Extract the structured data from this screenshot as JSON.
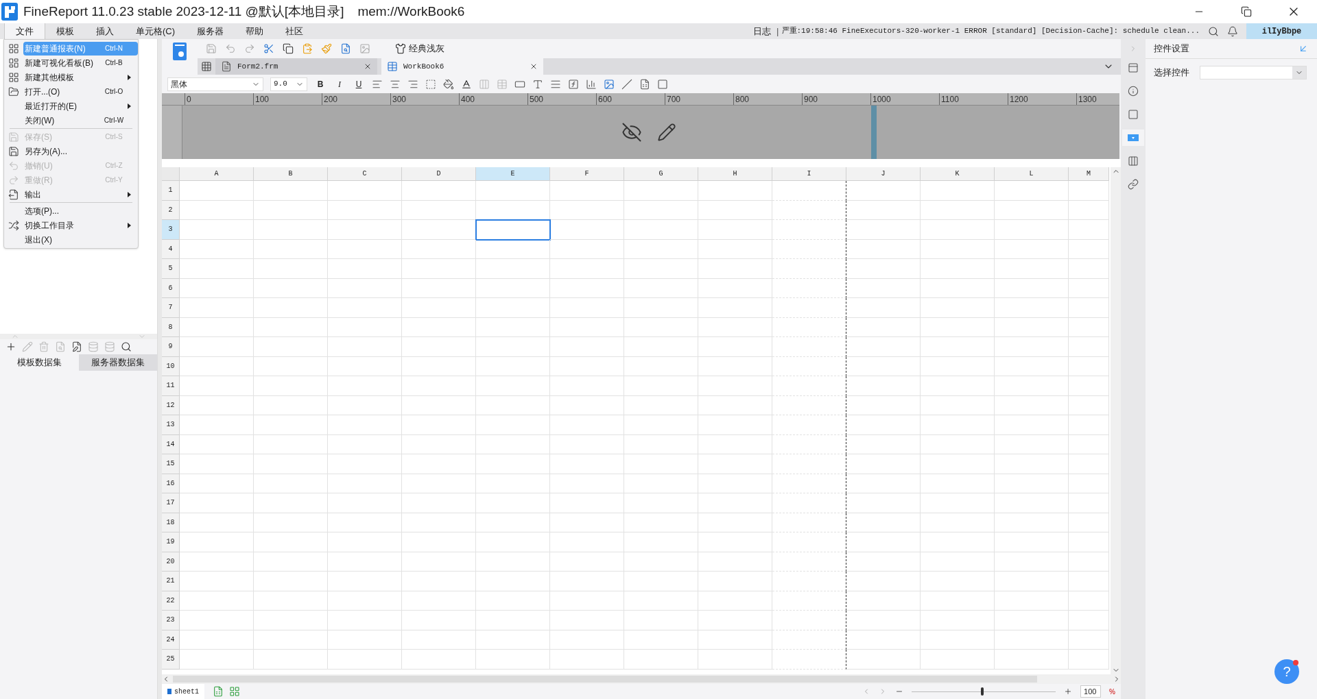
{
  "window": {
    "title": "FineReport 11.0.23 stable 2023-12-11 @默认[本地目录]",
    "path": "mem://WorkBook6"
  },
  "menu_bar": [
    {
      "label": "文件",
      "selected": true
    },
    {
      "label": "模板",
      "selected": false
    },
    {
      "label": "插入",
      "selected": false
    },
    {
      "label": "单元格(C)",
      "selected": false
    },
    {
      "label": "服务器",
      "selected": false
    },
    {
      "label": "帮助",
      "selected": false
    },
    {
      "label": "社区",
      "selected": false
    }
  ],
  "log": {
    "label": "日志",
    "separator": "|",
    "message": "严重:19:58:46 FineExecutors-320-worker-1 ERROR [standard] [Decision-Cache]: schedule clean..."
  },
  "user": "ilIyBbpe",
  "file_menu": [
    {
      "kind": "item",
      "label": "新建普通报表(N)",
      "shortcut": "Ctrl-N",
      "selected": true,
      "disabled": false,
      "submenu": false
    },
    {
      "kind": "item",
      "label": "新建可视化看板(B)",
      "shortcut": "Ctrl-B",
      "selected": false,
      "disabled": false,
      "submenu": false
    },
    {
      "kind": "item",
      "label": "新建其他模板",
      "selected": false,
      "disabled": false,
      "submenu": true
    },
    {
      "kind": "item",
      "label": "打开...(O)",
      "shortcut": "Ctrl-O",
      "selected": false,
      "disabled": false,
      "submenu": false
    },
    {
      "kind": "item",
      "label": "最近打开的(E)",
      "selected": false,
      "disabled": false,
      "submenu": true
    },
    {
      "kind": "item",
      "label": "关闭(W)",
      "shortcut": "Ctrl-W",
      "selected": false,
      "disabled": false,
      "submenu": false
    },
    {
      "kind": "separator"
    },
    {
      "kind": "item",
      "label": "保存(S)",
      "shortcut": "Ctrl-S",
      "selected": false,
      "disabled": true,
      "submenu": false
    },
    {
      "kind": "item",
      "label": "另存为(A)...",
      "selected": false,
      "disabled": false,
      "submenu": false
    },
    {
      "kind": "item",
      "label": "撤销(U)",
      "shortcut": "Ctrl-Z",
      "selected": false,
      "disabled": true,
      "submenu": false
    },
    {
      "kind": "item",
      "label": "重做(R)",
      "shortcut": "Ctrl-Y",
      "selected": false,
      "disabled": true,
      "submenu": false
    },
    {
      "kind": "item",
      "label": "输出",
      "selected": false,
      "disabled": false,
      "submenu": true
    },
    {
      "kind": "separator"
    },
    {
      "kind": "item",
      "label": "选项(P)...",
      "selected": false,
      "disabled": false,
      "submenu": false
    },
    {
      "kind": "item",
      "label": "切换工作目录",
      "selected": false,
      "disabled": false,
      "submenu": true
    },
    {
      "kind": "item",
      "label": "退出(X)",
      "selected": false,
      "disabled": false,
      "submenu": false
    }
  ],
  "dataset_tabs": [
    {
      "label": "模板数据集",
      "selected": true
    },
    {
      "label": "服务器数据集",
      "selected": false
    }
  ],
  "theme_button": "经典浅灰",
  "file_tabs": [
    {
      "label": "Form2.frm",
      "kind": "form",
      "selected": false
    },
    {
      "label": "WorkBook6",
      "kind": "workbook",
      "selected": true
    }
  ],
  "format_bar": {
    "font": "黑体",
    "size": "9.0",
    "styles": [
      "B",
      "I",
      "U"
    ]
  },
  "ruler": [
    "0",
    "100",
    "200",
    "300",
    "400",
    "500",
    "600",
    "700",
    "800",
    "900",
    "1000",
    "1100",
    "1200",
    "1300"
  ],
  "sheet": {
    "columns": [
      {
        "label": "A",
        "selected": false,
        "page_break": false
      },
      {
        "label": "B",
        "selected": false,
        "page_break": false
      },
      {
        "label": "C",
        "selected": false,
        "page_break": false
      },
      {
        "label": "D",
        "selected": false,
        "page_break": false
      },
      {
        "label": "E",
        "selected": true,
        "page_break": false
      },
      {
        "label": "F",
        "selected": false,
        "page_break": false
      },
      {
        "label": "G",
        "selected": false,
        "page_break": false
      },
      {
        "label": "H",
        "selected": false,
        "page_break": false
      },
      {
        "label": "I",
        "selected": false,
        "page_break": true
      },
      {
        "label": "J",
        "selected": false,
        "page_break": false
      },
      {
        "label": "K",
        "selected": false,
        "page_break": false
      },
      {
        "label": "L",
        "selected": false,
        "page_break": false
      },
      {
        "label": "M",
        "selected": false,
        "page_break": false
      }
    ],
    "rows": [
      {
        "label": "1",
        "selected": false
      },
      {
        "label": "2",
        "selected": false
      },
      {
        "label": "3",
        "selected": true
      },
      {
        "label": "4",
        "selected": false
      },
      {
        "label": "5",
        "selected": false
      },
      {
        "label": "6",
        "selected": false
      },
      {
        "label": "7",
        "selected": false
      },
      {
        "label": "8",
        "selected": false
      },
      {
        "label": "9",
        "selected": false
      },
      {
        "label": "10",
        "selected": false
      },
      {
        "label": "11",
        "selected": false
      },
      {
        "label": "12",
        "selected": false
      },
      {
        "label": "13",
        "selected": false
      },
      {
        "label": "14",
        "selected": false
      },
      {
        "label": "15",
        "selected": false
      },
      {
        "label": "16",
        "selected": false
      },
      {
        "label": "17",
        "selected": false
      },
      {
        "label": "18",
        "selected": false
      },
      {
        "label": "19",
        "selected": false
      },
      {
        "label": "20",
        "selected": false
      },
      {
        "label": "21",
        "selected": false
      },
      {
        "label": "22",
        "selected": false
      },
      {
        "label": "23",
        "selected": false
      },
      {
        "label": "24",
        "selected": false
      },
      {
        "label": "25",
        "selected": false
      }
    ]
  },
  "sheet_tabs": [
    {
      "label": "sheet1",
      "selected": true
    }
  ],
  "zoom": {
    "level": 0.49,
    "value": "100",
    "unit": "%"
  },
  "side_tools": [
    {
      "selected": false
    },
    {
      "selected": false
    },
    {
      "selected": false
    },
    {
      "selected": true
    },
    {
      "selected": false
    },
    {
      "selected": false
    }
  ],
  "widget_panel": {
    "title": "控件设置",
    "field_label": "选择控件"
  },
  "help": "?"
}
